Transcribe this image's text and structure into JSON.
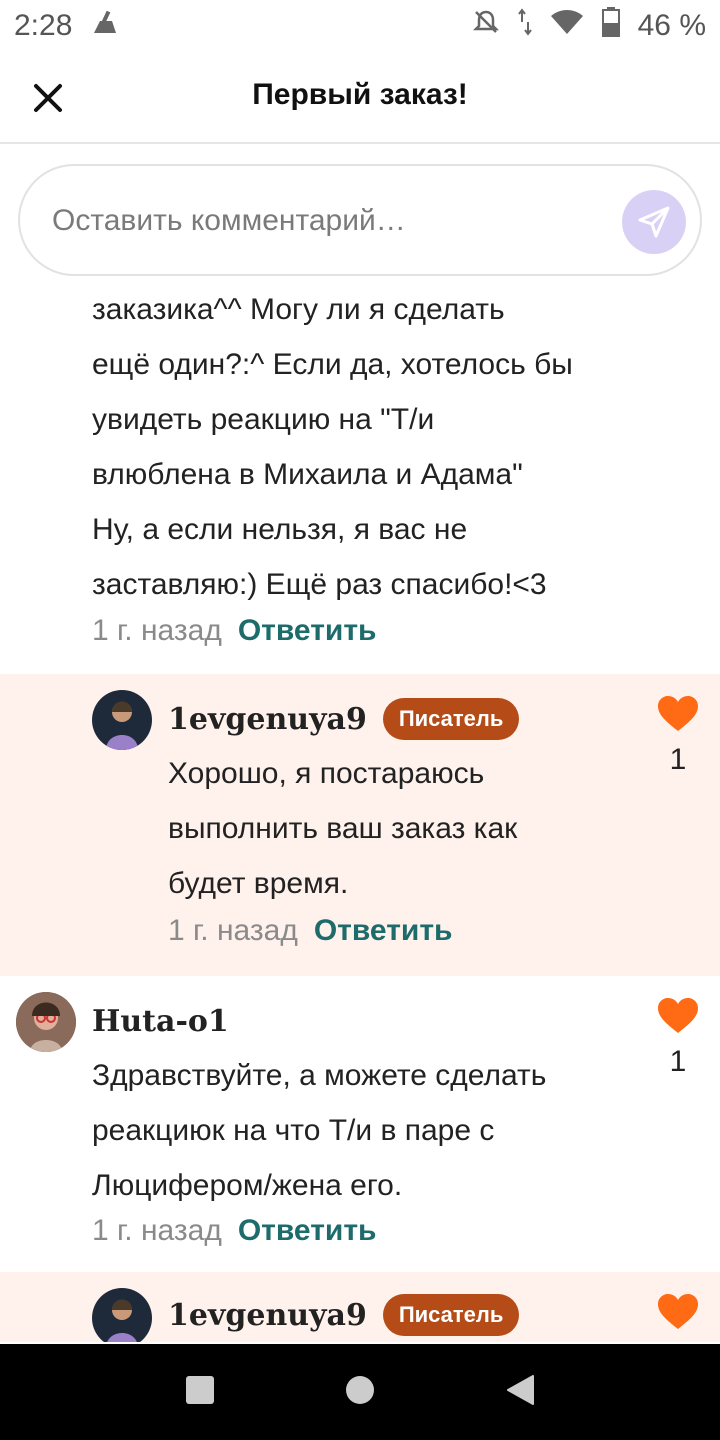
{
  "status": {
    "time": "2:28",
    "battery": "46 %"
  },
  "header": {
    "title": "Первый заказ!"
  },
  "comment_input": {
    "placeholder": "Оставить комментарий…"
  },
  "comments": [
    {
      "text_lines": [
        "заказика^^ Могу ли я сделать",
        "ещё один?:^ Если да, хотелось бы",
        "увидеть реакцию на \"Т/и",
        "влюблена в Михаила и Адама\"",
        "Ну, а если нельзя, я вас не",
        "заставляю:) Ещё раз спасибо!<3"
      ],
      "time": "1 г. назад",
      "reply": "Ответить"
    },
    {
      "user": "1evgenuya9",
      "badge": "Писатель",
      "text_lines": [
        "Хорошо, я постараюсь",
        "выполнить ваш заказ как",
        "будет время."
      ],
      "time": "1 г. назад",
      "reply": "Ответить",
      "likes": "1"
    },
    {
      "user": "Huta-o1",
      "text_lines": [
        "Здравствуйте, а можете сделать",
        "реакциюк на что Т/и в паре с",
        "Люцифером/жена его."
      ],
      "time": "1 г. назад",
      "reply": "Ответить",
      "likes": "1"
    },
    {
      "user": "1evgenuya9",
      "badge": "Писатель"
    }
  ],
  "colors": {
    "accent": "#1d6b6b",
    "badge": "#b54b17",
    "heart": "#ff6a14",
    "reply_bg": "#fff1ec",
    "send_bg": "#d9d1f5"
  }
}
